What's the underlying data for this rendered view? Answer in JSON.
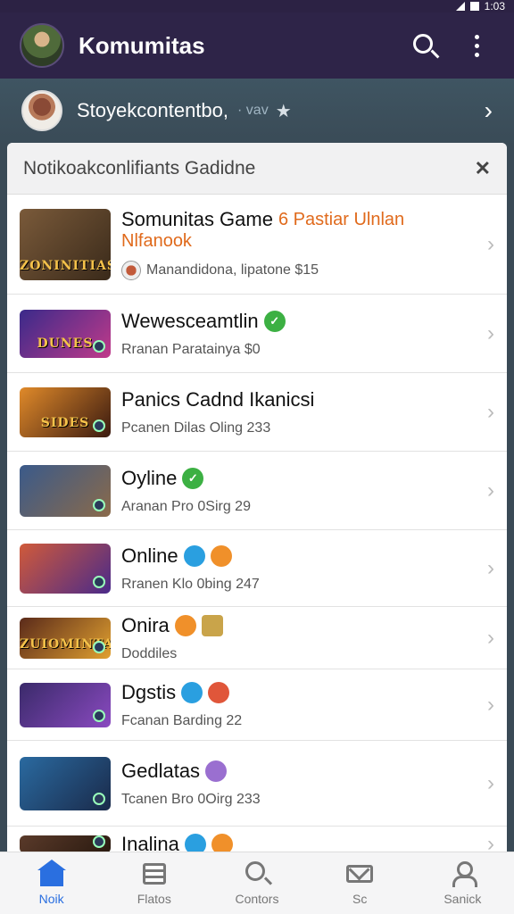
{
  "status_bar": {
    "time": "1:03"
  },
  "app_bar": {
    "title": "Komumitas"
  },
  "community": {
    "name": "Stoyekcontentbo,",
    "sub": "· vav",
    "star": "★",
    "chevron": "›"
  },
  "panel": {
    "title": "Notikoakconlifiants Gadidne",
    "close": "✕"
  },
  "items": [
    {
      "title": "Somunitas Game",
      "promo": "6 Pastiar Ulnlan",
      "promo2": "Nlfanook",
      "sub": "Manandidona, lipatone $15",
      "thumb": "ZONINITIAS",
      "thumb_colors": [
        "#7a5a3a",
        "#3a2a1a"
      ]
    },
    {
      "title": "Wewesceamtlin",
      "sub": "Rranan Paratainya $0",
      "thumb": "DUNES",
      "thumb_colors": [
        "#3a2a8a",
        "#c03a8a"
      ]
    },
    {
      "title": "Panics Cadnd Ikanicsi",
      "sub": "Pcanen Dilas Oling 233",
      "thumb": "SIDES",
      "thumb_colors": [
        "#e08a2a",
        "#3a1a10"
      ]
    },
    {
      "title": "Oyline",
      "sub": "Aranan Pro 0Sirg 29",
      "thumb": "",
      "thumb_colors": [
        "#3a5a8a",
        "#8a6a4a"
      ]
    },
    {
      "title": "Online",
      "sub": "Rranen Klo 0bing 247",
      "thumb": "",
      "thumb_colors": [
        "#d05a3a",
        "#4a2a8a"
      ]
    },
    {
      "title": "Onira",
      "sub": "Doddiles",
      "thumb": "ZUIOMINTAR",
      "thumb_colors": [
        "#5a2a1a",
        "#e0a030"
      ]
    },
    {
      "title": "Dgstis",
      "sub": "Fcanan Barding 22",
      "thumb": "",
      "thumb_colors": [
        "#3a2a6a",
        "#8a4ac0"
      ]
    },
    {
      "title": "Gedlatas",
      "sub": "Tcanen Bro 0Oirg 233",
      "thumb": "",
      "thumb_colors": [
        "#2a6aa0",
        "#1a2a4a"
      ]
    },
    {
      "title": "Inalina",
      "sub": "",
      "thumb": "",
      "thumb_colors": [
        "#5a3a2a",
        "#2a1a10"
      ]
    }
  ],
  "nav": [
    {
      "label": "Noik",
      "icon": "home-icon",
      "active": true
    },
    {
      "label": "Flatos",
      "icon": "list-icon",
      "active": false
    },
    {
      "label": "Contors",
      "icon": "search-icon",
      "active": false
    },
    {
      "label": "Sc",
      "icon": "mail-icon",
      "active": false
    },
    {
      "label": "Sanick",
      "icon": "profile-icon",
      "active": false
    }
  ]
}
